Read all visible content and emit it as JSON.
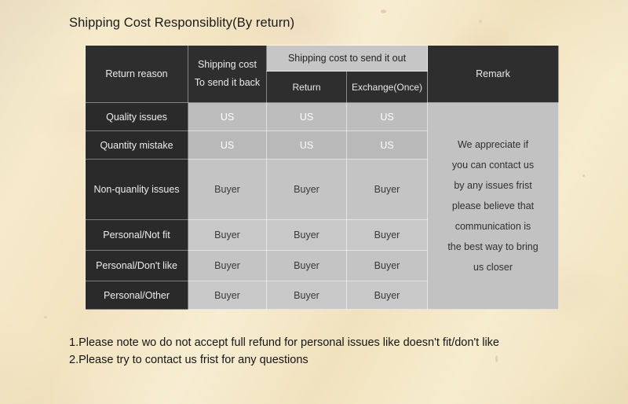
{
  "title": "Shipping Cost Responsiblity(By return)",
  "table": {
    "header": {
      "return_reason": "Return reason",
      "send_back_line1": "Shipping cost",
      "send_back_line2": "To send it back",
      "send_out_group": "Shipping cost to send it out",
      "send_out_return": "Return",
      "send_out_exchange": "Exchange(Once)",
      "remark": "Remark"
    },
    "rows": [
      {
        "reason": "Quality issues",
        "send_back": "US",
        "return": "US",
        "exchange": "US"
      },
      {
        "reason": "Quantity mistake",
        "send_back": "US",
        "return": "US",
        "exchange": "US"
      },
      {
        "reason": "Non-quanlity issues",
        "send_back": "Buyer",
        "return": "Buyer",
        "exchange": "Buyer"
      },
      {
        "reason": "Personal/Not fit",
        "send_back": "Buyer",
        "return": "Buyer",
        "exchange": "Buyer"
      },
      {
        "reason": "Personal/Don't like",
        "send_back": "Buyer",
        "return": "Buyer",
        "exchange": "Buyer"
      },
      {
        "reason": "Personal/Other",
        "send_back": "Buyer",
        "return": "Buyer",
        "exchange": "Buyer"
      }
    ],
    "remark_lines": [
      "We appreciate if",
      "you can contact us",
      "by any issues frist",
      "please believe that",
      "communication is",
      "the best way to bring",
      "us closer"
    ]
  },
  "notes": [
    "1.Please note wo do not accept full refund for personal issues like doesn't fit/don't like",
    "2.Please try to contact us frist for any questions"
  ],
  "colors": {
    "header_dark": "#2e2e2e",
    "header_light": "#c6c6c6",
    "cell_gray": "#c2c2c2",
    "paper": "#f2e4c4",
    "text_light": "#e9e9e9",
    "text_dark": "#303030"
  }
}
